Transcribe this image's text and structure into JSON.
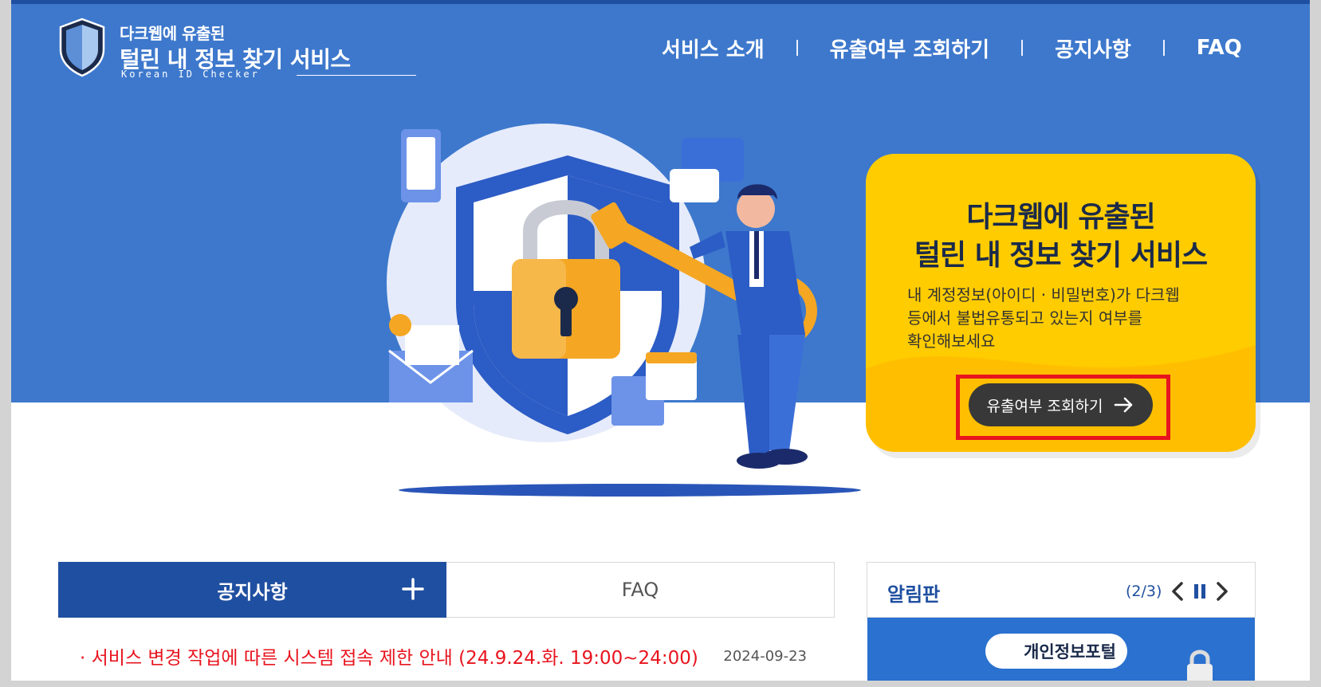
{
  "header": {
    "logo": {
      "line1": "다크웹에 유출된",
      "line2": "털린 내 정보 찾기 서비스",
      "english": "Korean ID Checker"
    },
    "nav": [
      {
        "label": "서비스 소개"
      },
      {
        "label": "유출여부 조회하기"
      },
      {
        "label": "공지사항"
      },
      {
        "label": "FAQ"
      }
    ]
  },
  "hero_card": {
    "title_line1": "다크웹에 유출된",
    "title_line2": "털린 내 정보 찾기 서비스",
    "desc_line1": "내 계정정보(아이디 · 비밀번호)가 다크웹",
    "desc_line2": "등에서 불법유통되고 있는지 여부를",
    "desc_line3": "확인해보세요",
    "cta_label": "유출여부 조회하기"
  },
  "tabs": {
    "notice_label": "공지사항",
    "faq_label": "FAQ"
  },
  "notices": [
    {
      "title": "· 서비스 변경 작업에 따른 시스템 접속 제한 안내 (24.9.24.화. 19:00~24:00)",
      "date": "2024-09-23"
    }
  ],
  "board": {
    "title": "알림판",
    "page": "(2/3)",
    "banner_text": "개인정보포털"
  },
  "colors": {
    "primary_blue": "#3d78cc",
    "navy": "#1f4fa0",
    "card_yellow": "#ffcc00",
    "cta_dark": "#383838",
    "highlight_red": "#e8141e"
  },
  "icons": [
    "shield-icon",
    "plus-icon",
    "arrow-right-icon",
    "chevron-left-icon",
    "pause-icon",
    "chevron-right-icon",
    "lock-icon"
  ]
}
